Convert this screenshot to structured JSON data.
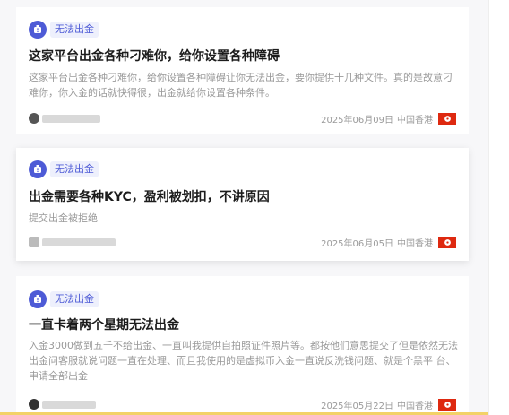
{
  "colors": {
    "accent": "#4e5bd6",
    "flag_red": "#de2910"
  },
  "cards": [
    {
      "badge": "无法出金",
      "title": "这家平台出金各种刁难你，给你设置各种障碍",
      "desc": "这家平台出金各种刁难你，给你设置各种障碍让你无法出金，要你提供十几种文件。真的是故意刁难你，你入金的话就快得很，出金就给你设置各种条件。",
      "date": "2025年06月09日",
      "region": "中国香港"
    },
    {
      "badge": "无法出金",
      "title": "出金需要各种KYC，盈利被划扣，不讲原因",
      "desc": "提交出金被拒绝",
      "date": "2025年06月05日",
      "region": "中国香港"
    },
    {
      "badge": "无法出金",
      "title": "一直卡着两个星期无法出金",
      "desc": "入金3000做到五千不给出金、一直叫我提供自拍照证件照片等。都按他们意思提交了但是依然无法出金问客服就说问题一直在处理、而且我使用的是虚拟币入金一直说反洗钱问题、就是个黑平 台、申请全部出金",
      "date": "2025年05月22日",
      "region": "中国香港"
    }
  ],
  "icons": {
    "badge": "hazard-icon",
    "flag": "hong-kong-flag-icon",
    "avatar": "avatar"
  }
}
